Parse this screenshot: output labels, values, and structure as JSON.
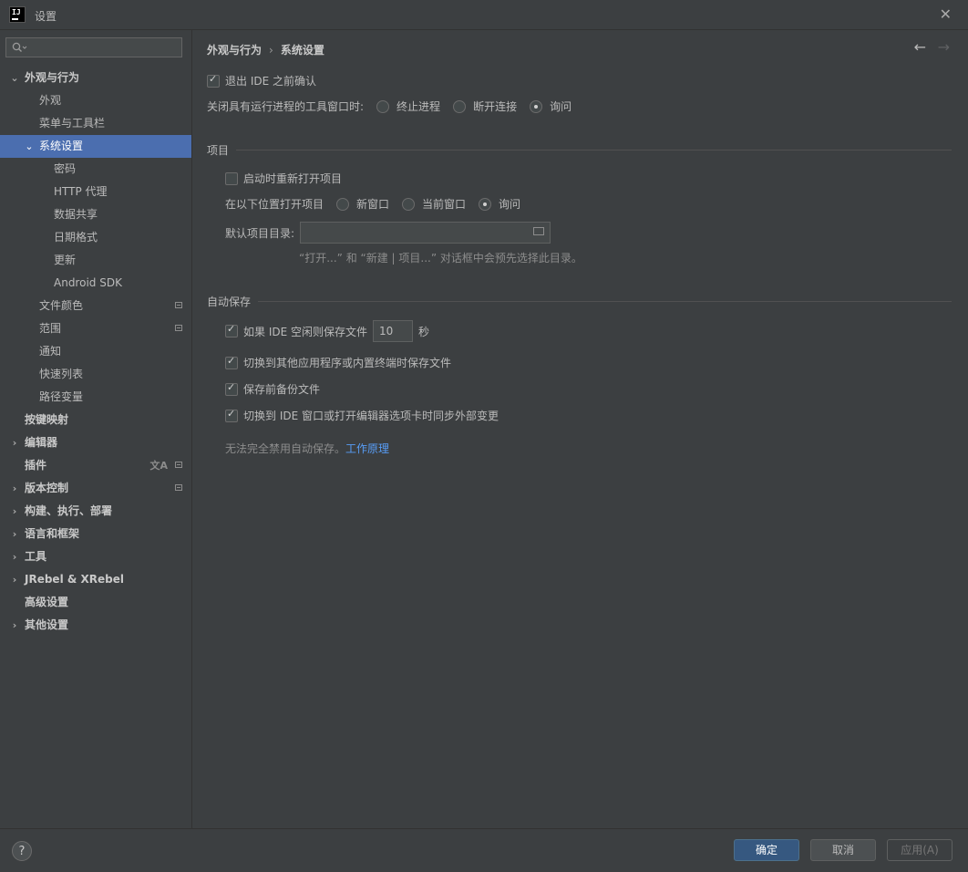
{
  "window": {
    "title": "设置"
  },
  "sidebar": {
    "search_placeholder": "",
    "items": [
      {
        "label": "外观与行为"
      },
      {
        "label": "外观"
      },
      {
        "label": "菜单与工具栏"
      },
      {
        "label": "系统设置"
      },
      {
        "label": "密码"
      },
      {
        "label": "HTTP 代理"
      },
      {
        "label": "数据共享"
      },
      {
        "label": "日期格式"
      },
      {
        "label": "更新"
      },
      {
        "label": "Android SDK"
      },
      {
        "label": "文件颜色"
      },
      {
        "label": "范围"
      },
      {
        "label": "通知"
      },
      {
        "label": "快速列表"
      },
      {
        "label": "路径变量"
      },
      {
        "label": "按键映射"
      },
      {
        "label": "编辑器"
      },
      {
        "label": "插件"
      },
      {
        "label": "版本控制"
      },
      {
        "label": "构建、执行、部署"
      },
      {
        "label": "语言和框架"
      },
      {
        "label": "工具"
      },
      {
        "label": "JRebel & XRebel"
      },
      {
        "label": "高级设置"
      },
      {
        "label": "其他设置"
      }
    ]
  },
  "breadcrumb": {
    "parent": "外观与行为",
    "current": "系统设置"
  },
  "general": {
    "confirm_exit": "退出 IDE 之前确认",
    "close_tool_label": "关闭具有运行进程的工具窗口时:",
    "close_options": [
      "终止进程",
      "断开连接",
      "询问"
    ]
  },
  "project": {
    "header": "项目",
    "reopen": "启动时重新打开项目",
    "open_location_label": "在以下位置打开项目",
    "open_options": [
      "新窗口",
      "当前窗口",
      "询问"
    ],
    "default_dir_label": "默认项目目录:",
    "default_dir_value": "",
    "hint": "“打开...” 和 “新建 | 项目...” 对话框中会预先选择此目录。"
  },
  "autosave": {
    "header": "自动保存",
    "idle_label": "如果 IDE 空闲则保存文件",
    "idle_seconds": "10",
    "idle_unit": "秒",
    "switch_app": "切换到其他应用程序或内置终端时保存文件",
    "backup": "保存前备份文件",
    "sync_external": "切换到 IDE 窗口或打开编辑器选项卡时同步外部变更",
    "note": "无法完全禁用自动保存。",
    "link": "工作原理"
  },
  "footer": {
    "ok": "确定",
    "cancel": "取消",
    "apply": "应用(A)",
    "help": "?"
  }
}
